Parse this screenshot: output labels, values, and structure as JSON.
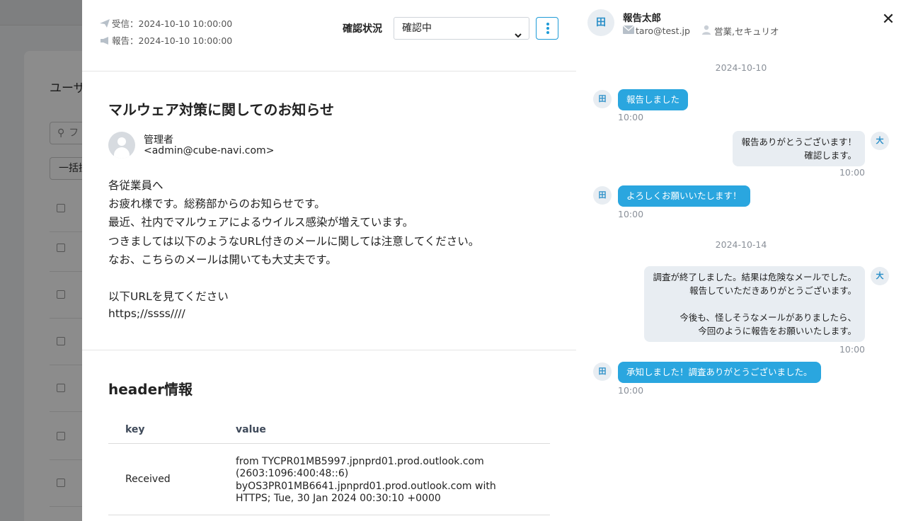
{
  "background": {
    "title": "ユーザ",
    "search_placeholder": "フ",
    "bulk_label": "一括操"
  },
  "header": {
    "received_label": "受信：2024-10-10 10:00:00",
    "reported_label": "報告：2024-10-10 10:00:00",
    "status_label": "確認状況",
    "status_value": "確認中",
    "status_options": [
      "確認中"
    ]
  },
  "mail": {
    "subject": "マルウェア対策に関してのお知らせ",
    "sender_name": "管理者",
    "sender_email": "<admin@cube-navi.com>",
    "body_lines": [
      "各従業員へ",
      "お疲れ様です。総務部からのお知らせです。",
      "最近、社内でマルウェアによるウイルス感染が増えています。",
      "つきましては以下のようなURL付きのメールに関しては注意してください。",
      "なお、こちらのメールは開いても大丈夫です。",
      "",
      "以下URLを見てください",
      "https;//ssss////"
    ]
  },
  "header_info": {
    "title": "header情報",
    "col_key": "key",
    "col_value": "value",
    "rows": [
      {
        "key": "Received",
        "value_lines": [
          "from TYCPR01MB5997.jpnprd01.prod.outlook.com",
          "(2603:1096:400:48::6)",
          "byOS3PR01MB6641.jpnprd01.prod.outlook.com with",
          "HTTPS; Tue, 30 Jan 2024 00:30:10 +0000"
        ]
      }
    ]
  },
  "reporter": {
    "avatar_text": "田",
    "name": "報告太郎",
    "email": "taro@test.jp",
    "departments": "営業,セキュリオ"
  },
  "chat": {
    "days": [
      "2024-10-10",
      "2024-10-14"
    ],
    "messages": [
      {
        "side": "left",
        "avatar": "田",
        "lines": [
          "報告しました"
        ],
        "time": "10:00"
      },
      {
        "side": "right",
        "avatar": "大",
        "lines": [
          "報告ありがとうございます！",
          "確認します。"
        ],
        "time": "10:00"
      },
      {
        "side": "left",
        "avatar": "田",
        "lines": [
          "よろしくお願いいたします！"
        ],
        "time": "10:00"
      },
      {
        "side": "right",
        "avatar": "大",
        "lines": [
          "調査が終了しました。結果は危険なメールでした。",
          "報告していただきありがとうございます。",
          "",
          "今後も、怪しそうなメールがありましたら、",
          "今回のように報告をお願いいたします。"
        ],
        "time": "10:00"
      },
      {
        "side": "left",
        "avatar": "田",
        "lines": [
          "承知しました！調査ありがとうございました。"
        ],
        "time": "10:00"
      }
    ]
  },
  "colors": {
    "accent": "#2aa6df",
    "kebab_border": "#1e9bd7",
    "bubble_right": "#e8edf2"
  },
  "icons": {
    "received": "paper-plane-icon",
    "reported": "megaphone-icon",
    "email": "envelope-icon",
    "department": "person-icon",
    "close": "close-icon",
    "menu": "kebab-menu-icon",
    "select": "chevron-down-icon"
  }
}
